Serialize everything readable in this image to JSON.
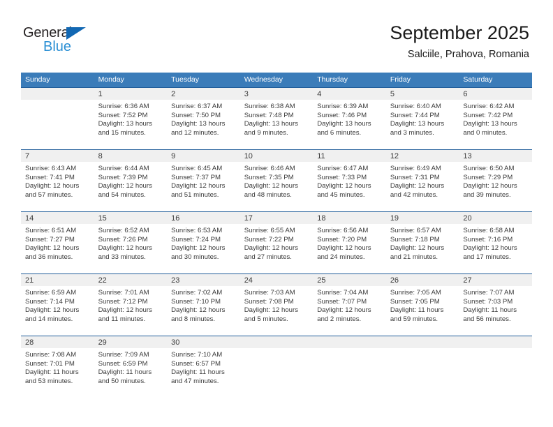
{
  "brand": {
    "name_part1": "General",
    "name_part2": "Blue",
    "triangle_color": "#1268b3",
    "blue_color": "#2a8fd4"
  },
  "header": {
    "title": "September 2025",
    "subtitle": "Salciile, Prahova, Romania",
    "header_bg": "#3b7cb9",
    "row_border": "#1f5c99",
    "daynum_bg": "#f0f0f0"
  },
  "weekdays": [
    "Sunday",
    "Monday",
    "Tuesday",
    "Wednesday",
    "Thursday",
    "Friday",
    "Saturday"
  ],
  "weeks": [
    [
      {
        "day": "",
        "lines": []
      },
      {
        "day": "1",
        "lines": [
          "Sunrise: 6:36 AM",
          "Sunset: 7:52 PM",
          "Daylight: 13 hours",
          "and 15 minutes."
        ]
      },
      {
        "day": "2",
        "lines": [
          "Sunrise: 6:37 AM",
          "Sunset: 7:50 PM",
          "Daylight: 13 hours",
          "and 12 minutes."
        ]
      },
      {
        "day": "3",
        "lines": [
          "Sunrise: 6:38 AM",
          "Sunset: 7:48 PM",
          "Daylight: 13 hours",
          "and 9 minutes."
        ]
      },
      {
        "day": "4",
        "lines": [
          "Sunrise: 6:39 AM",
          "Sunset: 7:46 PM",
          "Daylight: 13 hours",
          "and 6 minutes."
        ]
      },
      {
        "day": "5",
        "lines": [
          "Sunrise: 6:40 AM",
          "Sunset: 7:44 PM",
          "Daylight: 13 hours",
          "and 3 minutes."
        ]
      },
      {
        "day": "6",
        "lines": [
          "Sunrise: 6:42 AM",
          "Sunset: 7:42 PM",
          "Daylight: 13 hours",
          "and 0 minutes."
        ]
      }
    ],
    [
      {
        "day": "7",
        "lines": [
          "Sunrise: 6:43 AM",
          "Sunset: 7:41 PM",
          "Daylight: 12 hours",
          "and 57 minutes."
        ]
      },
      {
        "day": "8",
        "lines": [
          "Sunrise: 6:44 AM",
          "Sunset: 7:39 PM",
          "Daylight: 12 hours",
          "and 54 minutes."
        ]
      },
      {
        "day": "9",
        "lines": [
          "Sunrise: 6:45 AM",
          "Sunset: 7:37 PM",
          "Daylight: 12 hours",
          "and 51 minutes."
        ]
      },
      {
        "day": "10",
        "lines": [
          "Sunrise: 6:46 AM",
          "Sunset: 7:35 PM",
          "Daylight: 12 hours",
          "and 48 minutes."
        ]
      },
      {
        "day": "11",
        "lines": [
          "Sunrise: 6:47 AM",
          "Sunset: 7:33 PM",
          "Daylight: 12 hours",
          "and 45 minutes."
        ]
      },
      {
        "day": "12",
        "lines": [
          "Sunrise: 6:49 AM",
          "Sunset: 7:31 PM",
          "Daylight: 12 hours",
          "and 42 minutes."
        ]
      },
      {
        "day": "13",
        "lines": [
          "Sunrise: 6:50 AM",
          "Sunset: 7:29 PM",
          "Daylight: 12 hours",
          "and 39 minutes."
        ]
      }
    ],
    [
      {
        "day": "14",
        "lines": [
          "Sunrise: 6:51 AM",
          "Sunset: 7:27 PM",
          "Daylight: 12 hours",
          "and 36 minutes."
        ]
      },
      {
        "day": "15",
        "lines": [
          "Sunrise: 6:52 AM",
          "Sunset: 7:26 PM",
          "Daylight: 12 hours",
          "and 33 minutes."
        ]
      },
      {
        "day": "16",
        "lines": [
          "Sunrise: 6:53 AM",
          "Sunset: 7:24 PM",
          "Daylight: 12 hours",
          "and 30 minutes."
        ]
      },
      {
        "day": "17",
        "lines": [
          "Sunrise: 6:55 AM",
          "Sunset: 7:22 PM",
          "Daylight: 12 hours",
          "and 27 minutes."
        ]
      },
      {
        "day": "18",
        "lines": [
          "Sunrise: 6:56 AM",
          "Sunset: 7:20 PM",
          "Daylight: 12 hours",
          "and 24 minutes."
        ]
      },
      {
        "day": "19",
        "lines": [
          "Sunrise: 6:57 AM",
          "Sunset: 7:18 PM",
          "Daylight: 12 hours",
          "and 21 minutes."
        ]
      },
      {
        "day": "20",
        "lines": [
          "Sunrise: 6:58 AM",
          "Sunset: 7:16 PM",
          "Daylight: 12 hours",
          "and 17 minutes."
        ]
      }
    ],
    [
      {
        "day": "21",
        "lines": [
          "Sunrise: 6:59 AM",
          "Sunset: 7:14 PM",
          "Daylight: 12 hours",
          "and 14 minutes."
        ]
      },
      {
        "day": "22",
        "lines": [
          "Sunrise: 7:01 AM",
          "Sunset: 7:12 PM",
          "Daylight: 12 hours",
          "and 11 minutes."
        ]
      },
      {
        "day": "23",
        "lines": [
          "Sunrise: 7:02 AM",
          "Sunset: 7:10 PM",
          "Daylight: 12 hours",
          "and 8 minutes."
        ]
      },
      {
        "day": "24",
        "lines": [
          "Sunrise: 7:03 AM",
          "Sunset: 7:08 PM",
          "Daylight: 12 hours",
          "and 5 minutes."
        ]
      },
      {
        "day": "25",
        "lines": [
          "Sunrise: 7:04 AM",
          "Sunset: 7:07 PM",
          "Daylight: 12 hours",
          "and 2 minutes."
        ]
      },
      {
        "day": "26",
        "lines": [
          "Sunrise: 7:05 AM",
          "Sunset: 7:05 PM",
          "Daylight: 11 hours",
          "and 59 minutes."
        ]
      },
      {
        "day": "27",
        "lines": [
          "Sunrise: 7:07 AM",
          "Sunset: 7:03 PM",
          "Daylight: 11 hours",
          "and 56 minutes."
        ]
      }
    ],
    [
      {
        "day": "28",
        "lines": [
          "Sunrise: 7:08 AM",
          "Sunset: 7:01 PM",
          "Daylight: 11 hours",
          "and 53 minutes."
        ]
      },
      {
        "day": "29",
        "lines": [
          "Sunrise: 7:09 AM",
          "Sunset: 6:59 PM",
          "Daylight: 11 hours",
          "and 50 minutes."
        ]
      },
      {
        "day": "30",
        "lines": [
          "Sunrise: 7:10 AM",
          "Sunset: 6:57 PM",
          "Daylight: 11 hours",
          "and 47 minutes."
        ]
      },
      {
        "day": "",
        "lines": []
      },
      {
        "day": "",
        "lines": []
      },
      {
        "day": "",
        "lines": []
      },
      {
        "day": "",
        "lines": []
      }
    ]
  ]
}
